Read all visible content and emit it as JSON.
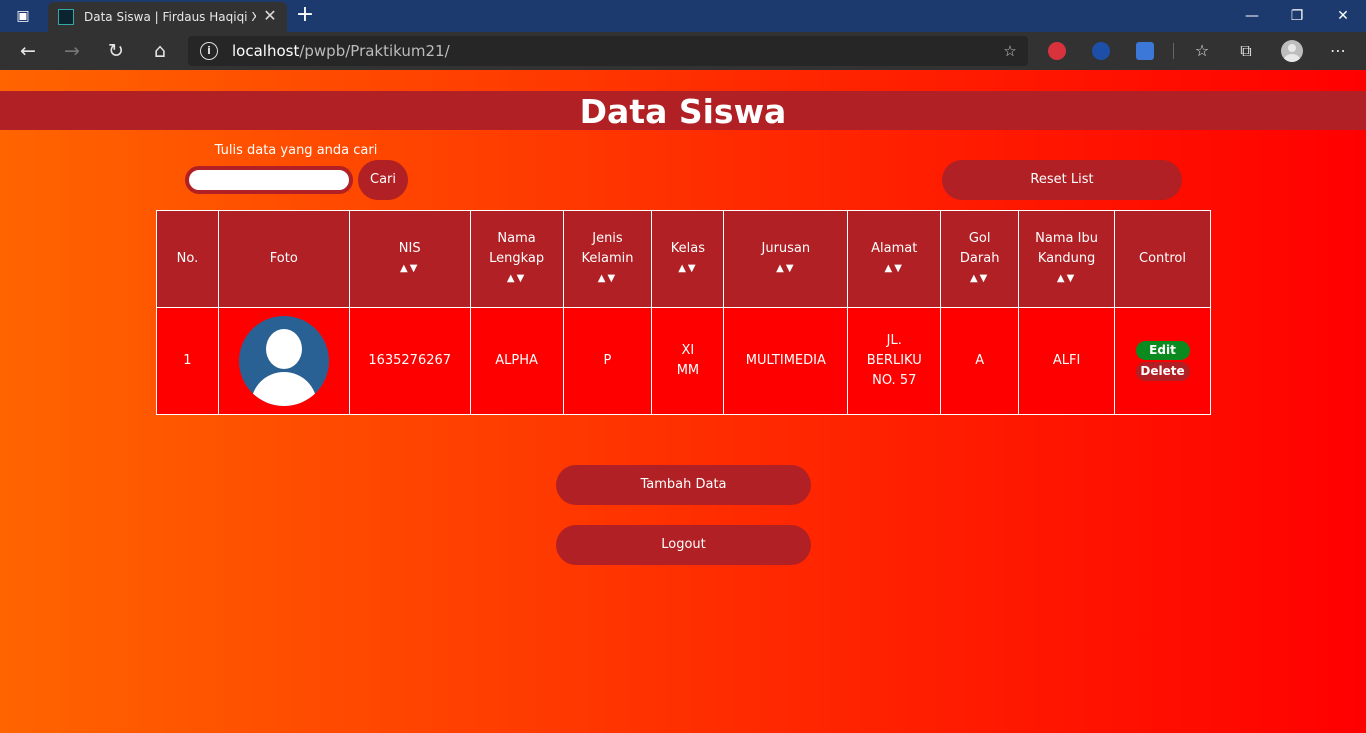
{
  "browser": {
    "tab_title": "Data Siswa | Firdaus Haqiqi XI RPL",
    "url_host": "localhost",
    "url_path": "/pwpb/Praktikum21/",
    "icons": {
      "menu": "tab-actions-icon",
      "back": "back-arrow-icon",
      "forward": "forward-arrow-icon",
      "reload": "reload-icon",
      "home": "home-icon",
      "info": "info-icon",
      "favorite_add": "add-favorite-icon",
      "favorites": "favorites-icon",
      "collections": "collections-icon",
      "more": "more-icon"
    }
  },
  "page": {
    "title": "Data Siswa",
    "search": {
      "label": "Tulis data yang anda cari",
      "value": "",
      "button": "Cari"
    },
    "reset_button": "Reset List",
    "add_button": "Tambah Data",
    "logout_button": "Logout",
    "colors": {
      "accent": "#b02024",
      "gradient_start": "#ff6400",
      "gradient_end": "#ff0000",
      "edit": "#0b8a1f"
    }
  },
  "table": {
    "headers": {
      "no": "No.",
      "foto": "Foto",
      "nis": "NIS",
      "nama_lengkap": "Nama Lengkap",
      "jenis_kelamin": "Jenis Kelamin",
      "kelas": "Kelas",
      "jurusan": "Jurusan",
      "alamat": "Alamat",
      "gol_darah": "Gol Darah",
      "nama_ibu": "Nama Ibu Kandung",
      "control": "Control"
    },
    "sort_up": "▲",
    "sort_down": "▼",
    "rows": [
      {
        "no": "1",
        "nis": "1635276267",
        "nama_lengkap": "ALPHA",
        "jenis_kelamin": "P",
        "kelas": "XI MM",
        "jurusan": "MULTIMEDIA",
        "alamat": "JL. BERLIKU NO. 57",
        "gol_darah": "A",
        "nama_ibu": "ALFI",
        "edit": "Edit",
        "delete": "Delete"
      }
    ]
  }
}
